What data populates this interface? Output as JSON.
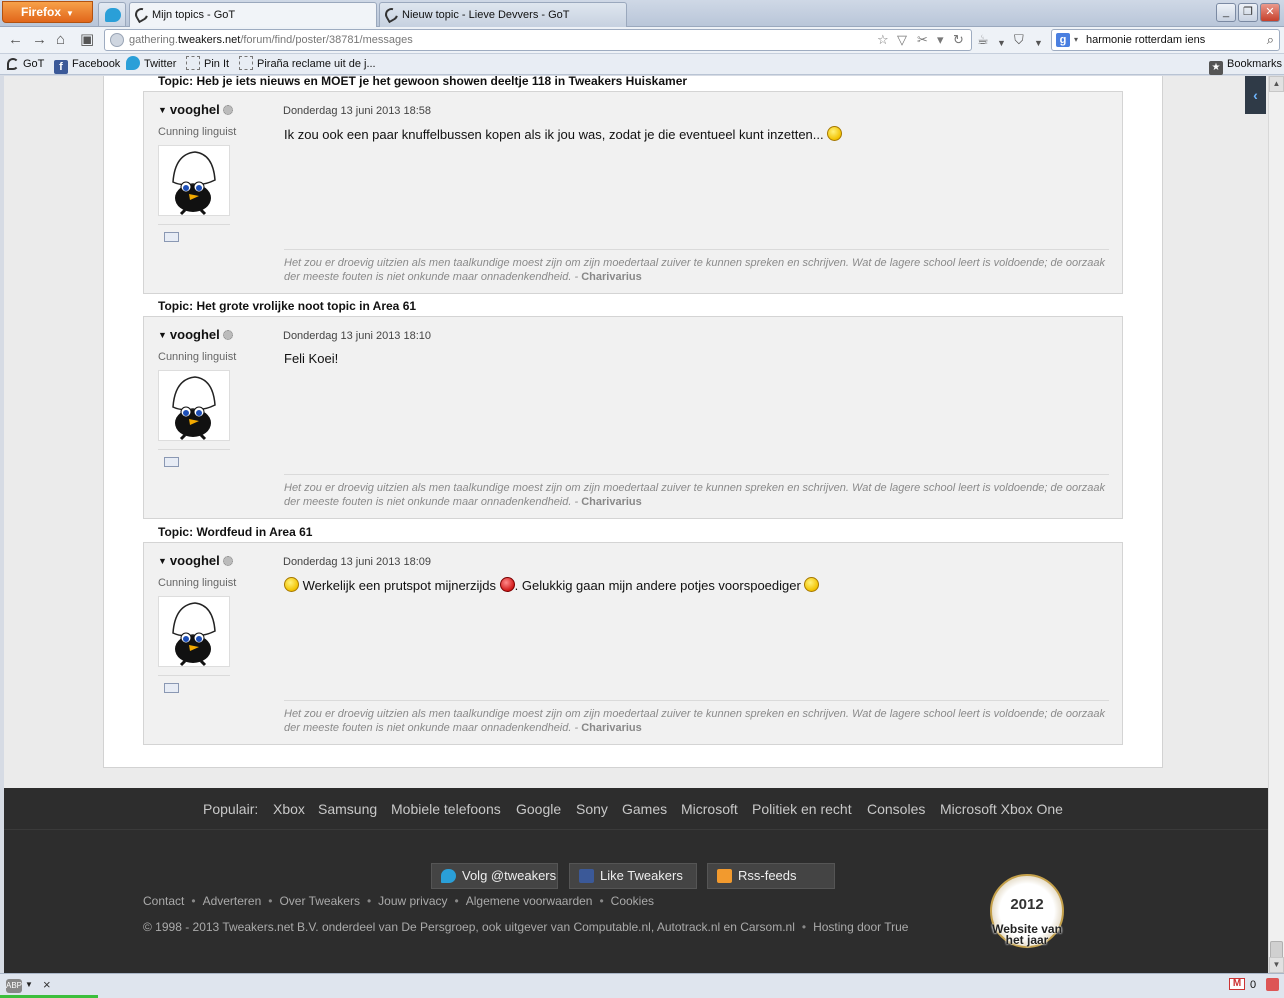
{
  "browser": {
    "menu_button": "Firefox",
    "tabs": [
      {
        "title": "Mijn topics - GoT",
        "active": true
      },
      {
        "title": "Nieuw topic - Lieve Devvers - GoT",
        "active": false
      }
    ],
    "url_prefix": "gathering.",
    "url_host": "tweakers.net",
    "url_path": "/forum/find/poster/38781/messages",
    "search_query": "harmonie rotterdam iens",
    "bookmarks": [
      "GoT",
      "Facebook",
      "Twitter",
      "Pin It",
      "Piraña reclame uit de j..."
    ],
    "bookmarks_menu": "Bookmarks"
  },
  "posts": [
    {
      "topic": "Topic: Heb je iets nieuws en MOET je het gewoon showen deeltje 118 in Tweakers Huiskamer",
      "author": "vooghel",
      "rank": "Cunning linguist",
      "date": "Donderdag 13 juni 2013 18:58",
      "message_parts": [
        "Ik zou ook een paar knuffelbussen kopen als ik jou was, zodat je die eventueel kunt inzetten..."
      ]
    },
    {
      "topic": "Topic: Het grote vrolijke noot topic in Area 61",
      "author": "vooghel",
      "rank": "Cunning linguist",
      "date": "Donderdag 13 juni 2013 18:10",
      "message_parts": [
        "Feli Koei!"
      ]
    },
    {
      "topic": "Topic: Wordfeud in Area 61",
      "author": "vooghel",
      "rank": "Cunning linguist",
      "date": "Donderdag 13 juni 2013 18:09",
      "message_parts": [
        "Werkelijk een prutspot mijnerzijds",
        ". Gelukkig gaan mijn andere potjes voorspoediger"
      ]
    }
  ],
  "signature": {
    "text": "Het zou er droevig uitzien als men taalkundige moest zijn om zijn moedertaal zuiver te kunnen spreken en schrijven. Wat de lagere school leert is voldoende; de oorzaak der meeste fouten is niet onkunde maar onnadenkendheid. -",
    "author": "Charivarius"
  },
  "footer": {
    "popular_label": "Populair:",
    "popular_links": [
      "Xbox",
      "Samsung",
      "Mobiele telefoons",
      "Google",
      "Sony",
      "Games",
      "Microsoft",
      "Politiek en recht",
      "Consoles",
      "Microsoft Xbox One"
    ],
    "social_buttons": [
      "Volg @tweakers",
      "Like Tweakers",
      "Rss-feeds"
    ],
    "links": [
      "Contact",
      "Adverteren",
      "Over Tweakers",
      "Jouw privacy",
      "Algemene voorwaarden",
      "Cookies"
    ],
    "copyright": "© 1998 - 2013 Tweakers.net B.V. onderdeel van De Persgroep, ook uitgever van Computable.nl, Autotrack.nl en Carsom.nl",
    "hosting": "Hosting door True",
    "award_year": "2012",
    "award_text": "Website van het jaar"
  },
  "statusbar": {
    "abp": "ABP",
    "close": "×",
    "mail_count": "0"
  },
  "colors": {
    "footer_bg": "#2d2d2d",
    "post_bg": "#f1f1f1",
    "firefox_orange": "#e1661a"
  }
}
